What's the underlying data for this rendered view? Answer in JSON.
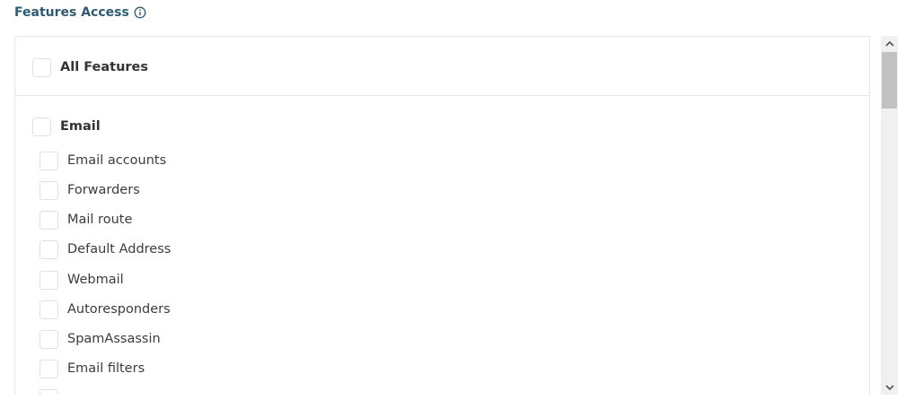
{
  "section": {
    "title": "Features Access",
    "info_icon": "info-circle-icon"
  },
  "all_features": {
    "label": "All Features",
    "checked": false
  },
  "groups": [
    {
      "label": "Email",
      "checked": false,
      "items": [
        {
          "label": "Email accounts",
          "checked": false
        },
        {
          "label": "Forwarders",
          "checked": false
        },
        {
          "label": "Mail route",
          "checked": false
        },
        {
          "label": "Default Address",
          "checked": false
        },
        {
          "label": "Webmail",
          "checked": false
        },
        {
          "label": "Autoresponders",
          "checked": false
        },
        {
          "label": "SpamAssassin",
          "checked": false
        },
        {
          "label": "Email filters",
          "checked": false
        }
      ]
    }
  ],
  "colors": {
    "title": "#2e5a74",
    "border": "#e3e6e8",
    "checkbox_border": "#dde1e4",
    "scroll_track": "#f0f0f0",
    "scroll_thumb": "#c1c1c1"
  }
}
